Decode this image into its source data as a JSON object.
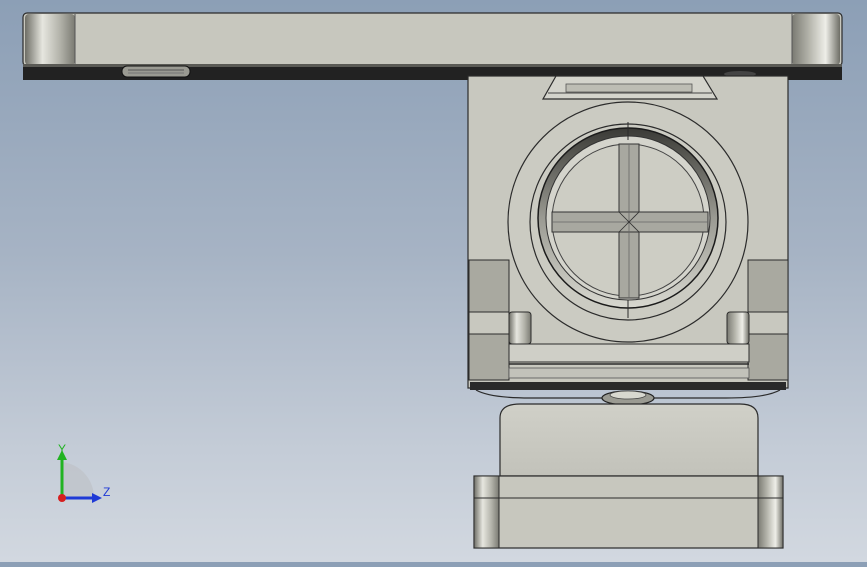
{
  "viewport": {
    "background_top": "#8c9fb6",
    "background_bottom": "#d2d8e0",
    "part_color": "#c8c8bf"
  },
  "triad": {
    "y_label": "Y",
    "z_label": "Z",
    "y_color": "#22b322",
    "z_color": "#1f3ad6",
    "x_color": "#d61f1f"
  }
}
